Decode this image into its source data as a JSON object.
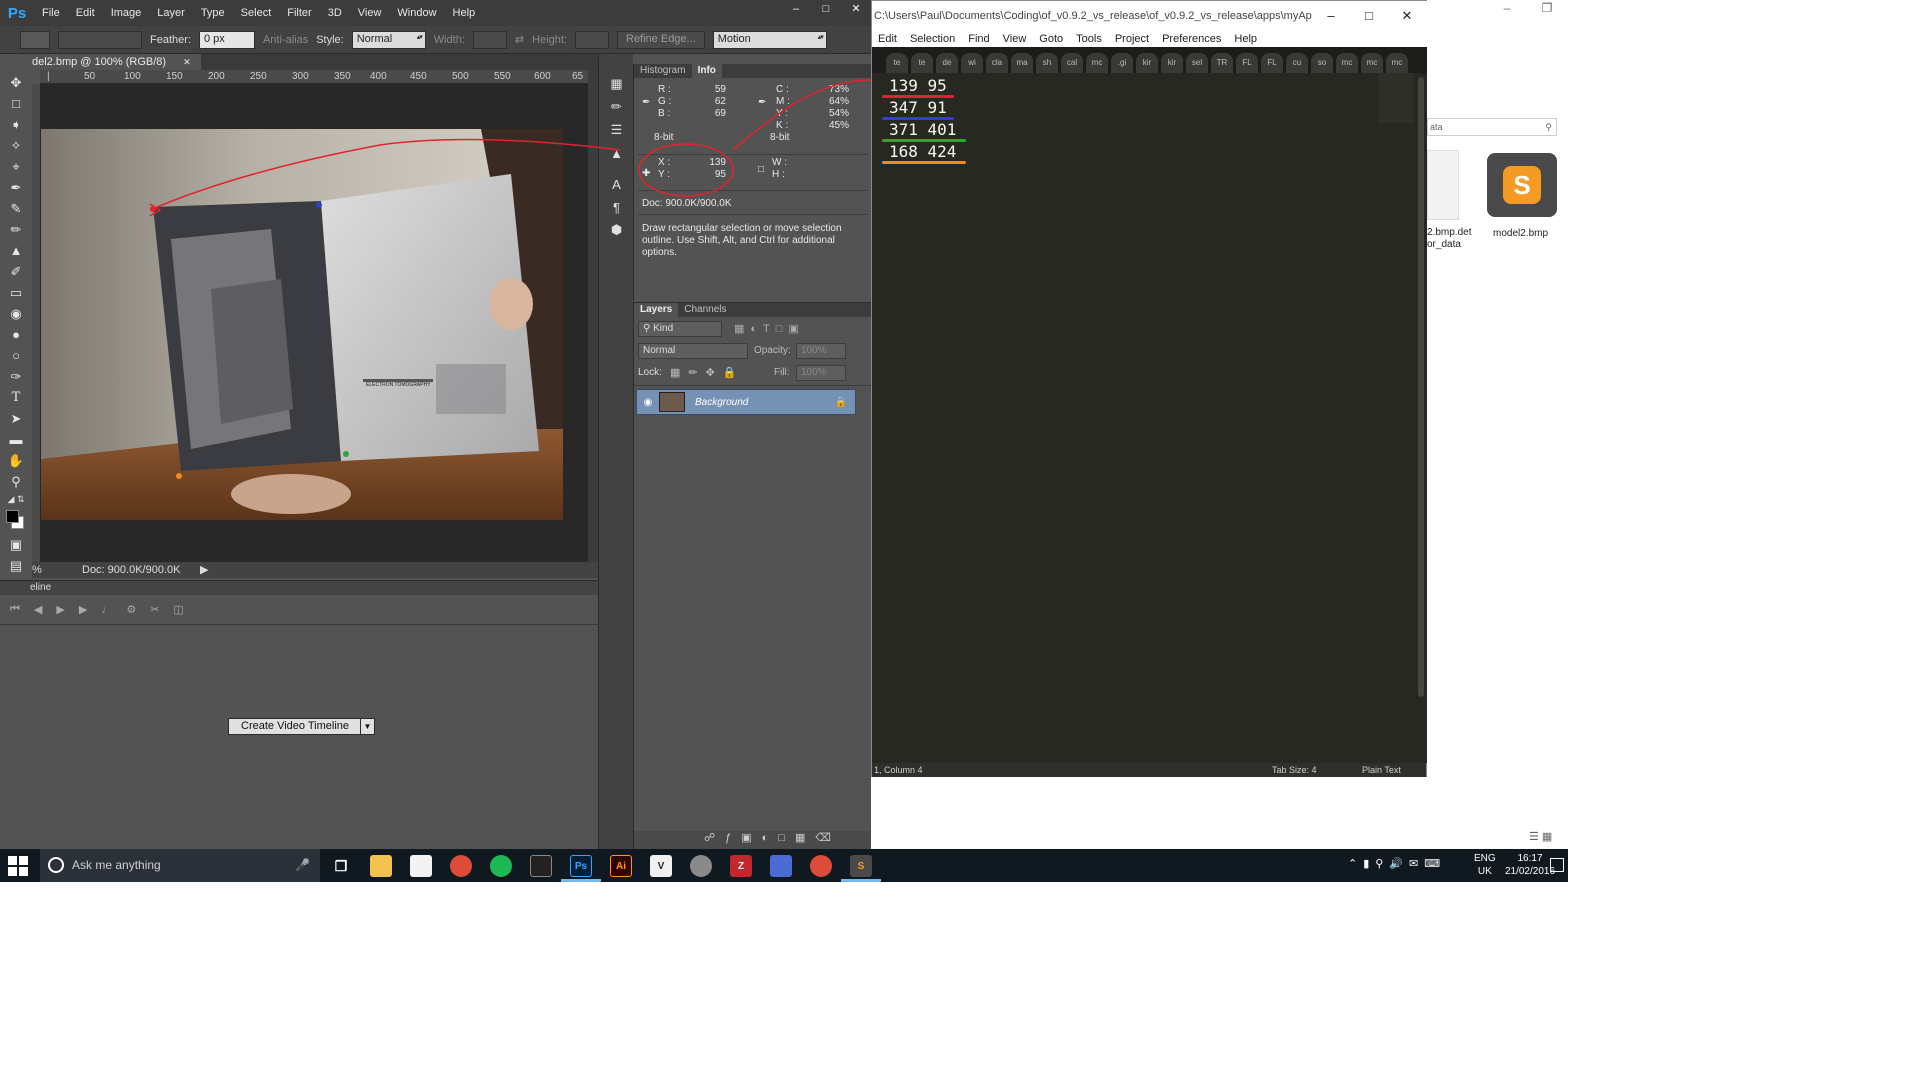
{
  "photoshop": {
    "logo": "Ps",
    "menu": [
      "File",
      "Edit",
      "Image",
      "Layer",
      "Type",
      "Select",
      "Filter",
      "3D",
      "View",
      "Window",
      "Help"
    ],
    "options": {
      "feather_label": "Feather:",
      "feather_value": "0 px",
      "antialias_label": "Anti-alias",
      "style_label": "Style:",
      "style_value": "Normal",
      "width_label": "Width:",
      "height_label": "Height:",
      "refine_edge": "Refine Edge...",
      "workspace": "Motion"
    },
    "document": {
      "tab_title": "del2.bmp @ 100% (RGB/8)",
      "ruler_ticks": [
        "50",
        "100",
        "150",
        "200",
        "250",
        "300",
        "350",
        "400",
        "450",
        "500",
        "550",
        "600",
        "65"
      ],
      "status_zoom": "%",
      "status_doc": "Doc: 900.0K/900.0K"
    },
    "timeline": {
      "title": "eline",
      "create_button": "Create Video Timeline"
    },
    "info": {
      "tabs": [
        "Histogram",
        "Info"
      ],
      "rgb": [
        {
          "label": "R :",
          "value": "59"
        },
        {
          "label": "G :",
          "value": "62"
        },
        {
          "label": "B :",
          "value": "69"
        }
      ],
      "rgb_bitdepth": "8-bit",
      "cmyk": [
        {
          "label": "C :",
          "value": "73%"
        },
        {
          "label": "M :",
          "value": "64%"
        },
        {
          "label": "Y :",
          "value": "54%"
        },
        {
          "label": "K :",
          "value": "45%"
        }
      ],
      "cmyk_bitdepth": "8-bit",
      "xy": [
        {
          "label": "X :",
          "value": "139"
        },
        {
          "label": "Y :",
          "value": "95"
        }
      ],
      "wh": [
        {
          "label": "W :"
        },
        {
          "label": "H :"
        }
      ],
      "doc": "Doc: 900.0K/900.0K",
      "hint": "Draw rectangular selection or move selection outline.  Use Shift, Alt, and Ctrl for additional options."
    },
    "layers": {
      "tabs": [
        "Layers",
        "Channels"
      ],
      "kind": "Kind",
      "blend_mode": "Normal",
      "opacity_label": "Opacity:",
      "opacity_value": "100%",
      "lock_label": "Lock:",
      "fill_label": "Fill:",
      "fill_value": "100%",
      "background_layer": "Background"
    },
    "book_heading": "ELECTRON TOMOGRAPHY"
  },
  "sublime": {
    "title": "C:\\Users\\Paul\\Documents\\Coding\\of_v0.9.2_vs_release\\of_v0.9.2_vs_release\\apps\\myApps\\reProj\\bi...",
    "menu": [
      "Edit",
      "Selection",
      "Find",
      "View",
      "Goto",
      "Tools",
      "Project",
      "Preferences",
      "Help"
    ],
    "tabs": [
      "te",
      "te",
      "de",
      "wi",
      "cla",
      "ma",
      "sh",
      "cal",
      "mc",
      ".gi",
      "kir",
      "kir",
      "sel",
      "TR",
      "FL",
      "FL",
      "cu",
      "so",
      "mc",
      "mc",
      "mc"
    ],
    "lines": [
      {
        "text": "139 95",
        "color": "#e0242f"
      },
      {
        "text": "347 91",
        "color": "#2f3fd0"
      },
      {
        "text": "371 401",
        "color": "#2aa837"
      },
      {
        "text": "168 424",
        "color": "#f08a24"
      }
    ],
    "status_left": "1, Column 4",
    "status_tab": "Tab Size: 4",
    "status_syntax": "Plain Text"
  },
  "explorer": {
    "search_placeholder": "ata",
    "file1": "2.bmp.det\nor_data",
    "file2": "model2.bmp"
  },
  "taskbar": {
    "search": "Ask me anything",
    "lang": "ENG",
    "region": "UK",
    "time": "16:17",
    "date": "21/02/2016"
  }
}
